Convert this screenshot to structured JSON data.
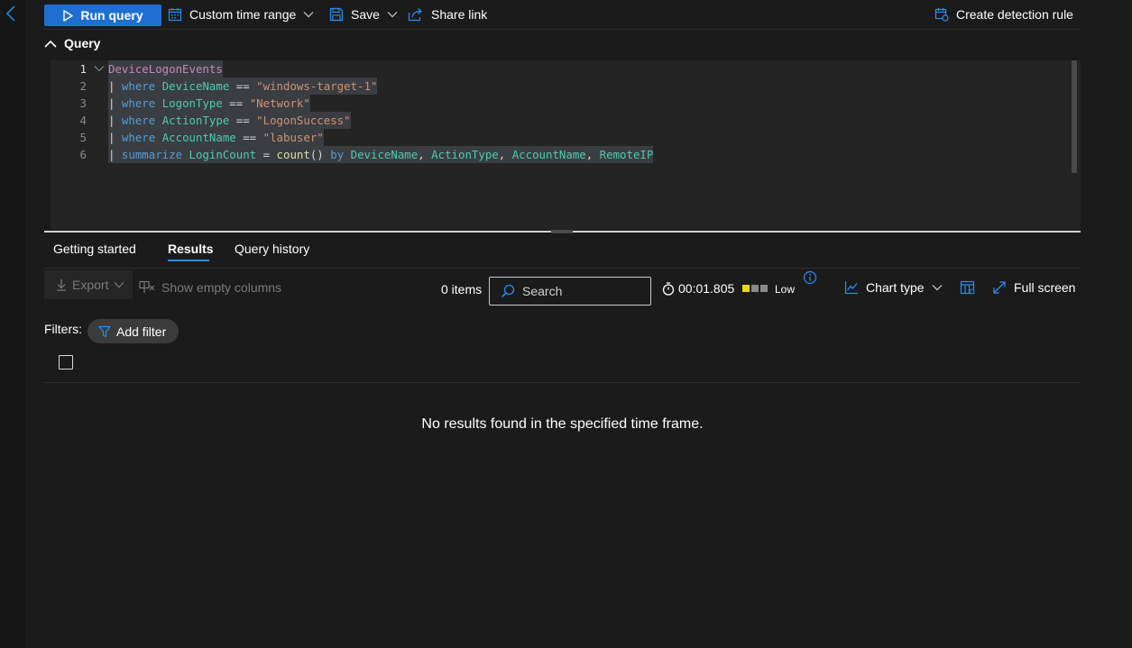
{
  "toolbar": {
    "run_label": "Run query",
    "time_range_label": "Custom time range",
    "save_label": "Save",
    "share_label": "Share link",
    "detection_label": "Create detection rule"
  },
  "query": {
    "header": "Query",
    "lines": [
      {
        "num": "1",
        "tokens": [
          {
            "t": "DeviceLogonEvents",
            "c": "tbl"
          }
        ]
      },
      {
        "num": "2",
        "tokens": [
          {
            "t": "| ",
            "c": "pipe"
          },
          {
            "t": "where",
            "c": "kw"
          },
          {
            "t": " ",
            "c": "op"
          },
          {
            "t": "DeviceName",
            "c": "col"
          },
          {
            "t": " == ",
            "c": "op"
          },
          {
            "t": "\"windows-target-1\"",
            "c": "str"
          }
        ]
      },
      {
        "num": "3",
        "tokens": [
          {
            "t": "| ",
            "c": "pipe"
          },
          {
            "t": "where",
            "c": "kw"
          },
          {
            "t": " ",
            "c": "op"
          },
          {
            "t": "LogonType",
            "c": "col"
          },
          {
            "t": " == ",
            "c": "op"
          },
          {
            "t": "\"Network\"",
            "c": "str"
          }
        ]
      },
      {
        "num": "4",
        "tokens": [
          {
            "t": "| ",
            "c": "pipe"
          },
          {
            "t": "where",
            "c": "kw"
          },
          {
            "t": " ",
            "c": "op"
          },
          {
            "t": "ActionType",
            "c": "col"
          },
          {
            "t": " == ",
            "c": "op"
          },
          {
            "t": "\"LogonSuccess\"",
            "c": "str"
          }
        ]
      },
      {
        "num": "5",
        "tokens": [
          {
            "t": "| ",
            "c": "pipe"
          },
          {
            "t": "where",
            "c": "kw"
          },
          {
            "t": " ",
            "c": "op"
          },
          {
            "t": "AccountName",
            "c": "col"
          },
          {
            "t": " == ",
            "c": "op"
          },
          {
            "t": "\"labuser\"",
            "c": "str"
          }
        ]
      },
      {
        "num": "6",
        "tokens": [
          {
            "t": "| ",
            "c": "pipe"
          },
          {
            "t": "summarize",
            "c": "kw"
          },
          {
            "t": " ",
            "c": "op"
          },
          {
            "t": "LoginCount",
            "c": "col"
          },
          {
            "t": " = ",
            "c": "op"
          },
          {
            "t": "count",
            "c": "fn"
          },
          {
            "t": "() ",
            "c": "op"
          },
          {
            "t": "by",
            "c": "kw"
          },
          {
            "t": " ",
            "c": "op"
          },
          {
            "t": "DeviceName",
            "c": "col"
          },
          {
            "t": ", ",
            "c": "op"
          },
          {
            "t": "ActionType",
            "c": "col"
          },
          {
            "t": ", ",
            "c": "op"
          },
          {
            "t": "AccountName",
            "c": "col"
          },
          {
            "t": ", ",
            "c": "op"
          },
          {
            "t": "RemoteIP",
            "c": "col"
          }
        ]
      }
    ]
  },
  "tabs": {
    "getting_started": "Getting started",
    "results": "Results",
    "query_history": "Query history"
  },
  "results_toolbar": {
    "export_label": "Export",
    "show_empty_label": "Show empty columns",
    "items_count": "0 items",
    "search_placeholder": "Search",
    "elapsed": "00:01.805",
    "usage_label": "Low",
    "chart_type_label": "Chart type",
    "full_screen_label": "Full screen"
  },
  "filters": {
    "label": "Filters:",
    "add_filter_label": "Add filter"
  },
  "empty_state": "No results found in the specified time frame.",
  "colors": {
    "accent": "#1f6fd1",
    "link_blue": "#2a8df0",
    "usage_active": "#e8d81a",
    "usage_inactive": "#8a8a8a"
  }
}
